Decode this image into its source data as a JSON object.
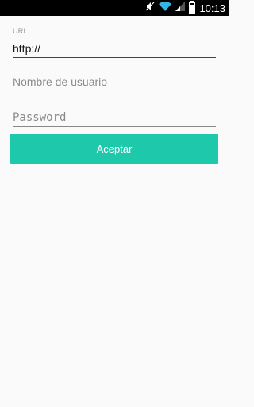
{
  "status_bar": {
    "time": "10:13",
    "icons": [
      "mute-icon",
      "wifi-icon",
      "signal-icon",
      "battery-icon"
    ],
    "battery_level": 0.8
  },
  "form": {
    "url_label": "URL",
    "url_value": "http://",
    "username_placeholder": "Nombre de usuario",
    "password_placeholder": "Password",
    "accept_label": "Aceptar"
  },
  "colors": {
    "accent": "#1ec8aa",
    "status_bar_bg": "#000000",
    "background": "#fafafa"
  }
}
